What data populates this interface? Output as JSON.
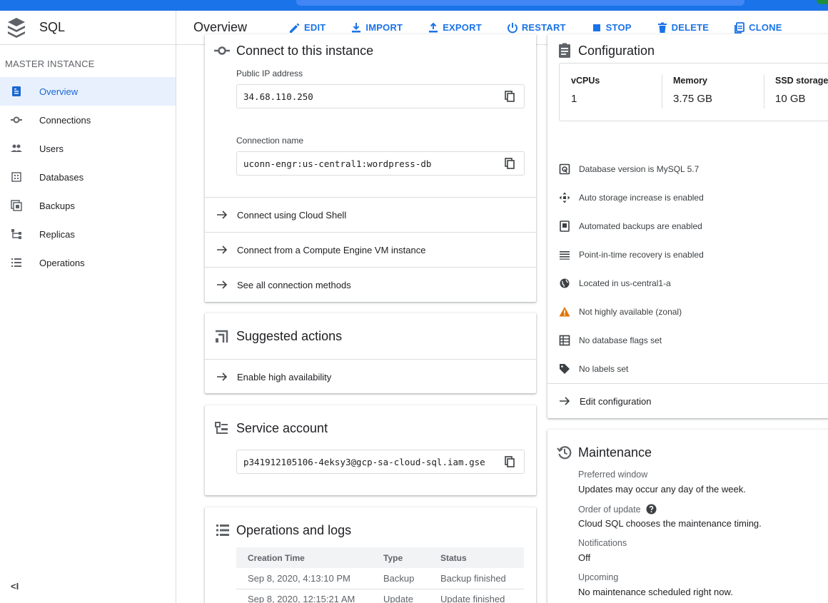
{
  "colors": {
    "accent": "#1a73e8",
    "warning": "#e37400",
    "active_bg": "#e8f0fe"
  },
  "sidebar": {
    "title": "SQL",
    "section_label": "MASTER INSTANCE",
    "items": [
      {
        "label": "Overview",
        "icon": "overview-icon",
        "active": true
      },
      {
        "label": "Connections",
        "icon": "connections-icon"
      },
      {
        "label": "Users",
        "icon": "users-icon"
      },
      {
        "label": "Databases",
        "icon": "databases-icon"
      },
      {
        "label": "Backups",
        "icon": "backups-icon"
      },
      {
        "label": "Replicas",
        "icon": "replicas-icon"
      },
      {
        "label": "Operations",
        "icon": "operations-icon"
      }
    ],
    "collapse_label": "<I"
  },
  "header": {
    "title": "Overview",
    "actions": [
      {
        "label": "EDIT",
        "icon": "pencil-icon"
      },
      {
        "label": "IMPORT",
        "icon": "import-icon"
      },
      {
        "label": "EXPORT",
        "icon": "export-icon"
      },
      {
        "label": "RESTART",
        "icon": "power-icon"
      },
      {
        "label": "STOP",
        "icon": "stop-icon"
      },
      {
        "label": "DELETE",
        "icon": "trash-icon"
      },
      {
        "label": "CLONE",
        "icon": "clone-icon"
      }
    ]
  },
  "connect": {
    "title": "Connect to this instance",
    "public_ip_label": "Public IP address",
    "public_ip": "34.68.110.250",
    "connection_name_label": "Connection name",
    "connection_name": "uconn-engr:us-central1:wordpress-db",
    "links": [
      "Connect using Cloud Shell",
      "Connect from a Compute Engine VM instance",
      "See all connection methods"
    ]
  },
  "suggested": {
    "title": "Suggested actions",
    "links": [
      "Enable high availability"
    ]
  },
  "service_account": {
    "title": "Service account",
    "value": "p341912105106-4eksy3@gcp-sa-cloud-sql.iam.gse"
  },
  "operations": {
    "title": "Operations and logs",
    "columns": [
      "Creation Time",
      "Type",
      "Status"
    ],
    "rows": [
      [
        "Sep 8, 2020, 4:13:10 PM",
        "Backup",
        "Backup finished"
      ],
      [
        "Sep 8, 2020, 12:15:21 AM",
        "Update",
        "Update finished"
      ]
    ]
  },
  "configuration": {
    "title": "Configuration",
    "specs": [
      {
        "label": "vCPUs",
        "value": "1"
      },
      {
        "label": "Memory",
        "value": "3.75 GB"
      },
      {
        "label": "SSD storage",
        "value": "10 GB"
      }
    ],
    "items": [
      {
        "text": "Database version is MySQL 5.7",
        "icon": "database-version-icon"
      },
      {
        "text": "Auto storage increase is enabled",
        "icon": "auto-storage-icon"
      },
      {
        "text": "Automated backups are enabled",
        "icon": "backup-icon"
      },
      {
        "text": "Point-in-time recovery is enabled",
        "icon": "recovery-icon"
      },
      {
        "text": "Located in us-central1-a",
        "icon": "globe-icon"
      },
      {
        "text": "Not highly available (zonal)",
        "icon": "warning-icon"
      },
      {
        "text": "No database flags set",
        "icon": "flags-table-icon"
      },
      {
        "text": "No labels set",
        "icon": "label-icon"
      }
    ],
    "edit_link": "Edit configuration"
  },
  "maintenance": {
    "title": "Maintenance",
    "preferred_window_label": "Preferred window",
    "preferred_window_value": "Updates may occur any day of the week.",
    "order_label": "Order of update",
    "order_value": "Cloud SQL chooses the maintenance timing.",
    "notifications_label": "Notifications",
    "notifications_value": "Off",
    "upcoming_label": "Upcoming",
    "upcoming_value": "No maintenance scheduled right now."
  }
}
